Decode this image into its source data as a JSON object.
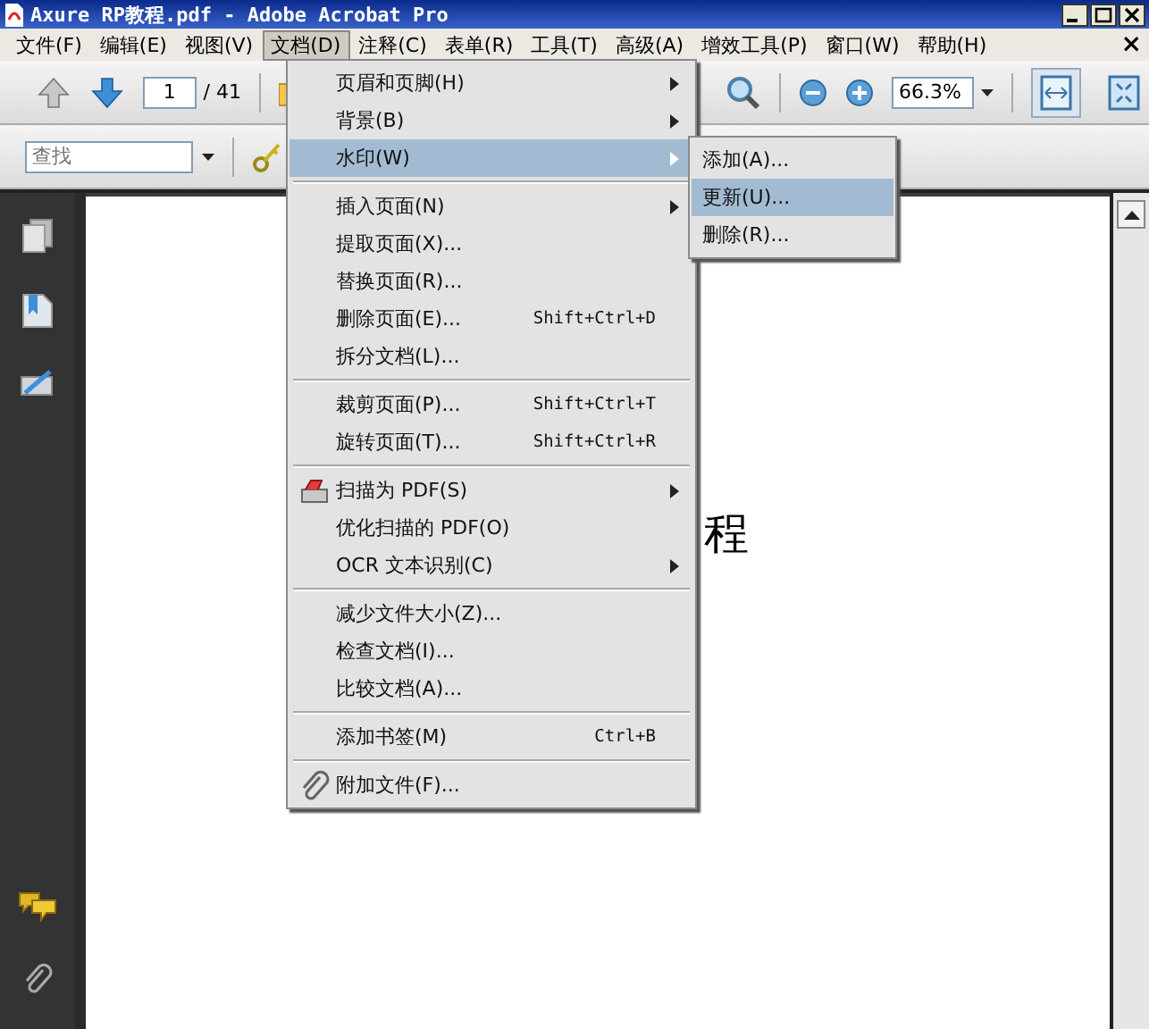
{
  "window": {
    "title": "Axure RP教程.pdf - Adobe Acrobat Pro"
  },
  "menubar": {
    "items": [
      {
        "label": "文件(F)",
        "selected": false
      },
      {
        "label": "编辑(E)",
        "selected": false
      },
      {
        "label": "视图(V)",
        "selected": false
      },
      {
        "label": "文档(D)",
        "selected": true
      },
      {
        "label": "注释(C)",
        "selected": false
      },
      {
        "label": "表单(R)",
        "selected": false
      },
      {
        "label": "工具(T)",
        "selected": false
      },
      {
        "label": "高级(A)",
        "selected": false
      },
      {
        "label": "增效工具(P)",
        "selected": false
      },
      {
        "label": "窗口(W)",
        "selected": false
      },
      {
        "label": "帮助(H)",
        "selected": false
      }
    ],
    "close_document": "×"
  },
  "toolbar": {
    "previous_disabled": true,
    "page": "1",
    "page_count": "/ 41",
    "zoom": "66.3%",
    "view_modes": [
      {
        "selected": true
      },
      {
        "selected": false
      }
    ]
  },
  "find_bar": {
    "placeholder": "查找"
  },
  "document": {
    "text": "程"
  },
  "menu": {
    "groups": [
      {
        "items": [
          {
            "label": "页眉和页脚(H)",
            "kind": "plain",
            "submenu": true,
            "selected": false
          },
          {
            "label": "背景(B)",
            "kind": "plain",
            "submenu": true,
            "selected": false
          },
          {
            "label": "水印(W)",
            "kind": "plain",
            "submenu": true,
            "selected": true
          }
        ]
      },
      {
        "items": [
          {
            "label": "插入页面(N)",
            "kind": "plain",
            "submenu": true,
            "selected": false
          },
          {
            "label": "提取页面(X)...",
            "kind": "plain",
            "submenu": false,
            "selected": false
          },
          {
            "label": "替换页面(R)...",
            "kind": "plain",
            "submenu": false,
            "selected": false
          },
          {
            "label": "删除页面(E)...",
            "kind": "plain",
            "submenu": false,
            "selected": false,
            "shortcut": "Shift+Ctrl+D"
          },
          {
            "label": "拆分文档(L)...",
            "kind": "plain",
            "submenu": false,
            "selected": false
          }
        ]
      },
      {
        "items": [
          {
            "label": "裁剪页面(P)...",
            "kind": "plain",
            "submenu": false,
            "selected": false,
            "shortcut": "Shift+Ctrl+T"
          },
          {
            "label": "旋转页面(T)...",
            "kind": "plain",
            "submenu": false,
            "selected": false,
            "shortcut": "Shift+Ctrl+R"
          }
        ]
      },
      {
        "items": [
          {
            "label": "扫描为 PDF(S)",
            "kind": "scan",
            "submenu": true,
            "selected": false
          },
          {
            "label": "优化扫描的 PDF(O)",
            "kind": "plain",
            "submenu": false,
            "selected": false
          },
          {
            "label": "OCR 文本识别(C)",
            "kind": "plain",
            "submenu": true,
            "selected": false
          }
        ]
      },
      {
        "items": [
          {
            "label": "减少文件大小(Z)...",
            "kind": "plain",
            "submenu": false,
            "selected": false
          },
          {
            "label": "检查文档(I)...",
            "kind": "plain",
            "submenu": false,
            "selected": false
          },
          {
            "label": "比较文档(A)...",
            "kind": "plain",
            "submenu": false,
            "selected": false
          }
        ]
      },
      {
        "items": [
          {
            "label": "添加书签(M)",
            "kind": "plain",
            "submenu": false,
            "selected": false,
            "shortcut": "Ctrl+B"
          }
        ]
      },
      {
        "items": [
          {
            "label": "附加文件(F)...",
            "kind": "attach",
            "submenu": false,
            "selected": false
          }
        ]
      }
    ]
  },
  "submenu": {
    "items": [
      {
        "label": "添加(A)...",
        "selected": false
      },
      {
        "label": "更新(U)...",
        "selected": true
      },
      {
        "label": "删除(R)...",
        "selected": false
      }
    ]
  }
}
